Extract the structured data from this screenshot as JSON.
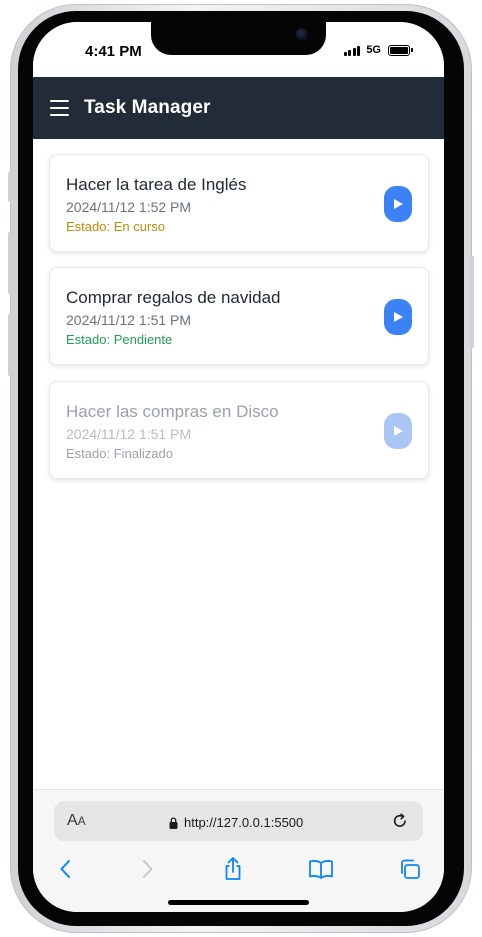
{
  "status_bar": {
    "time": "4:41 PM",
    "network": "5G"
  },
  "app_bar": {
    "title": "Task Manager"
  },
  "tasks": [
    {
      "title": "Hacer la tarea de Inglés",
      "date": "2024/11/12 1:52 PM",
      "status": "Estado: En curso",
      "status_color": "#c58a06",
      "state": "active"
    },
    {
      "title": "Comprar regalos de navidad",
      "date": "2024/11/12 1:51 PM",
      "status": "Estado: Pendiente",
      "status_color": "#1f9d55",
      "state": "active"
    },
    {
      "title": "Hacer las compras en Disco",
      "date": "2024/11/12 1:51 PM",
      "status": "Estado: Finalizado",
      "status_color": "#9aa1aa",
      "state": "done"
    }
  ],
  "browser": {
    "text_size_label": "AA",
    "url": "http://127.0.0.1:5500"
  },
  "colors": {
    "app_bar": "#222b38",
    "accent": "#3b82f6",
    "ios_blue": "#0a84ff"
  }
}
